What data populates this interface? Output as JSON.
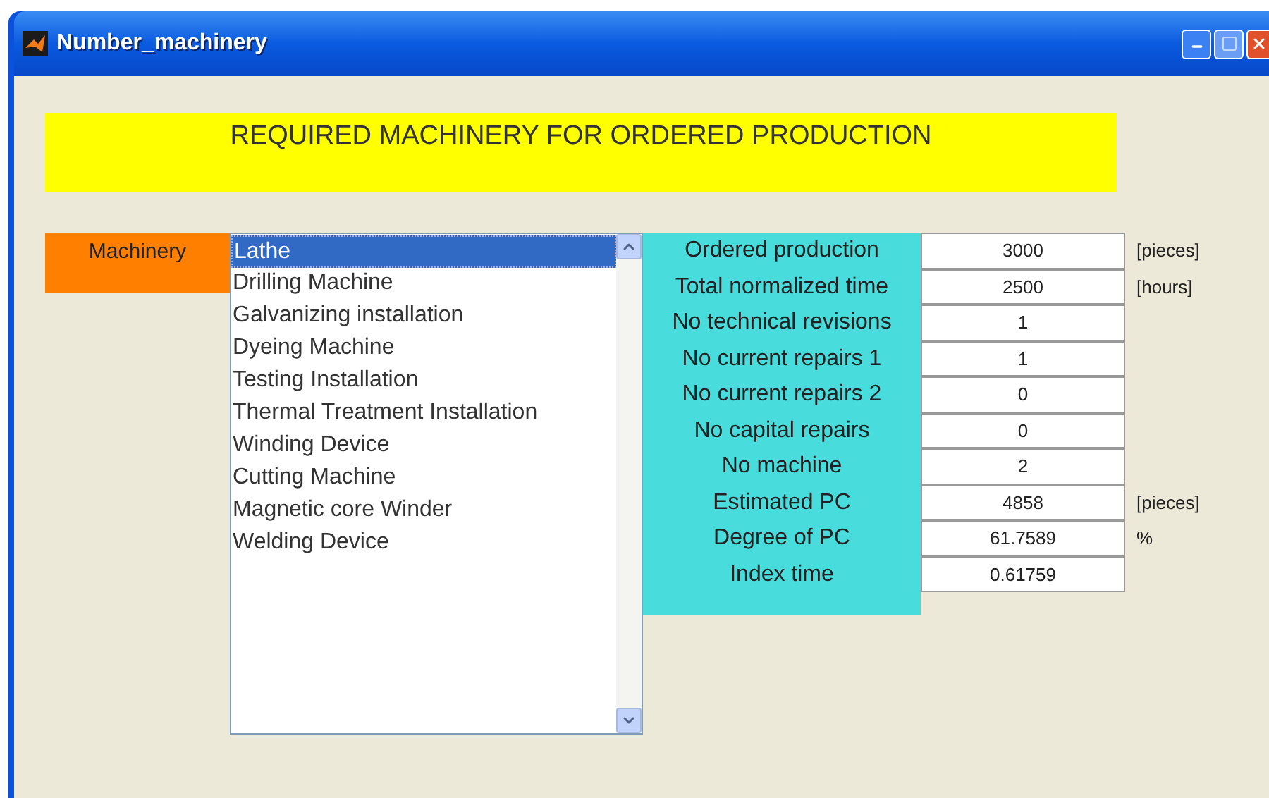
{
  "window": {
    "title": "Number_machinery"
  },
  "banner": "REQUIRED MACHINERY FOR ORDERED PRODUCTION",
  "machinery_label": "Machinery",
  "machinery_list": [
    {
      "label": "Lathe",
      "selected": true
    },
    {
      "label": "Drilling Machine",
      "selected": false
    },
    {
      "label": "Galvanizing installation",
      "selected": false
    },
    {
      "label": "Dyeing Machine",
      "selected": false
    },
    {
      "label": "Testing Installation",
      "selected": false
    },
    {
      "label": "Thermal Treatment Installation",
      "selected": false
    },
    {
      "label": "Winding Device",
      "selected": false
    },
    {
      "label": "Cutting Machine",
      "selected": false
    },
    {
      "label": "Magnetic core Winder",
      "selected": false
    },
    {
      "label": "Welding Device",
      "selected": false
    }
  ],
  "fields": [
    {
      "label": "Ordered production",
      "value": "3000",
      "unit": "[pieces]"
    },
    {
      "label": "Total normalized time",
      "value": "2500",
      "unit": "[hours]"
    },
    {
      "label": "No technical revisions",
      "value": "1"
    },
    {
      "label": "No current repairs 1",
      "value": "1"
    },
    {
      "label": "No current repairs 2",
      "value": "0"
    },
    {
      "label": "No capital repairs",
      "value": "0"
    },
    {
      "label": "No machine",
      "value": "2"
    },
    {
      "label": "Estimated PC",
      "value": "4858",
      "unit": "[pieces]"
    },
    {
      "label": "Degree of PC",
      "value": "61.7589",
      "unit": "%"
    },
    {
      "label": "Index time",
      "value": "0.61759"
    }
  ]
}
